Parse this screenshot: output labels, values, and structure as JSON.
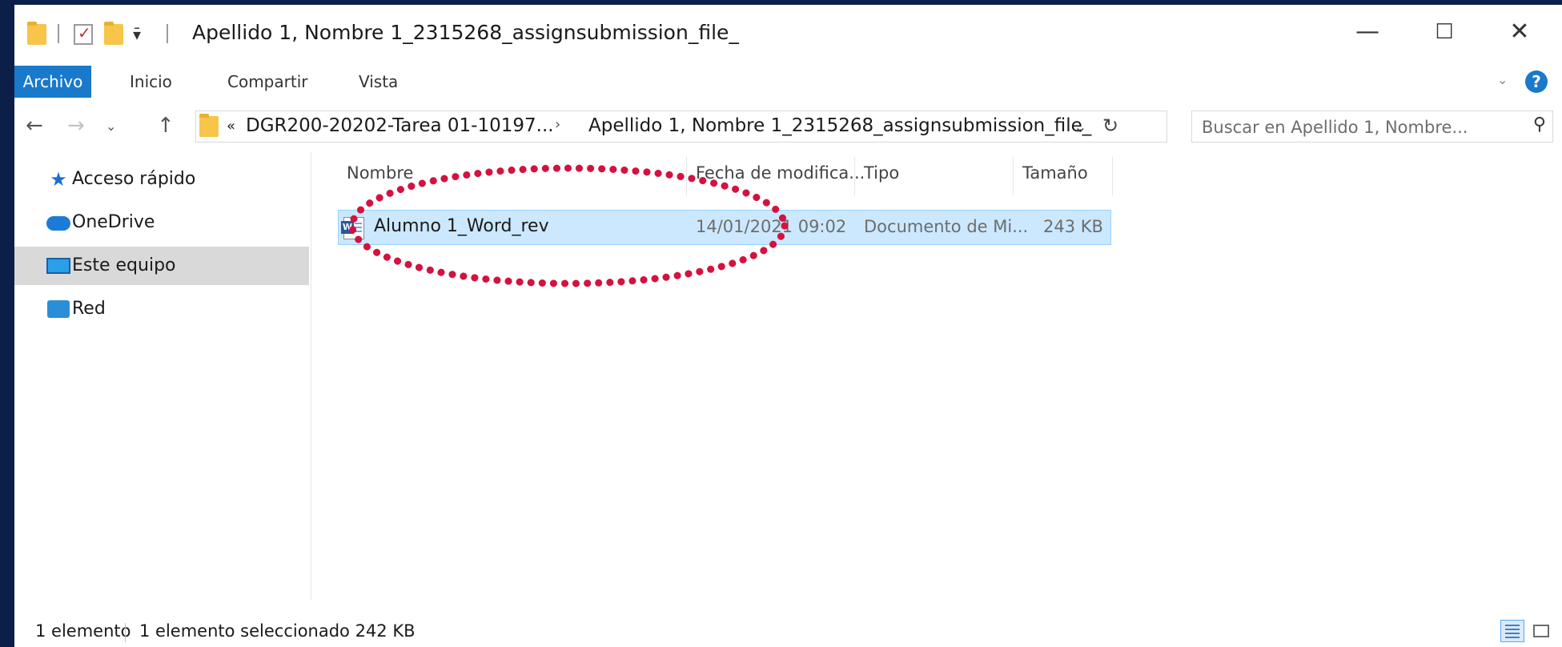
{
  "window": {
    "title": "Apellido 1, Nombre 1_2315268_assignsubmission_file_",
    "minimize_icon": "minimize-icon",
    "maximize_icon": "maximize-icon",
    "close_icon": "close-icon"
  },
  "quick_access": [
    "folder-icon",
    "properties-icon",
    "new-folder-icon",
    "customize-dropdown-icon"
  ],
  "ribbon": {
    "tabs": [
      "Archivo",
      "Inicio",
      "Compartir",
      "Vista"
    ],
    "active_tab": "Archivo",
    "accent_color": "#1979ca"
  },
  "address": {
    "overflow": "«",
    "crumbs": [
      "DGR200-20202-Tarea 01-10197...",
      "Apellido 1, Nombre 1_2315268_assignsubmission_file_"
    ]
  },
  "search": {
    "placeholder": "Buscar en Apellido 1, Nombre..."
  },
  "navigation": {
    "items": [
      {
        "label": "Acceso rápido",
        "icon": "star-icon"
      },
      {
        "label": "OneDrive",
        "icon": "cloud-icon"
      },
      {
        "label": "Este equipo",
        "icon": "computer-icon",
        "selected": true
      },
      {
        "label": "Red",
        "icon": "network-icon"
      }
    ]
  },
  "file_list": {
    "columns": [
      "Nombre",
      "Fecha de modifica...",
      "Tipo",
      "Tamaño"
    ],
    "rows": [
      {
        "name": "Alumno 1_Word_rev",
        "date": "14/01/2021 09:02",
        "type": "Documento de Mi...",
        "size": "243 KB",
        "icon": "word-document-icon",
        "selected": true
      }
    ],
    "selection_color": "#cce8ff"
  },
  "annotation": {
    "color": "#d4123f",
    "shape": "dotted-ellipse"
  },
  "status": {
    "count": "1 elemento",
    "selection": "1 elemento seleccionado  242 KB"
  }
}
